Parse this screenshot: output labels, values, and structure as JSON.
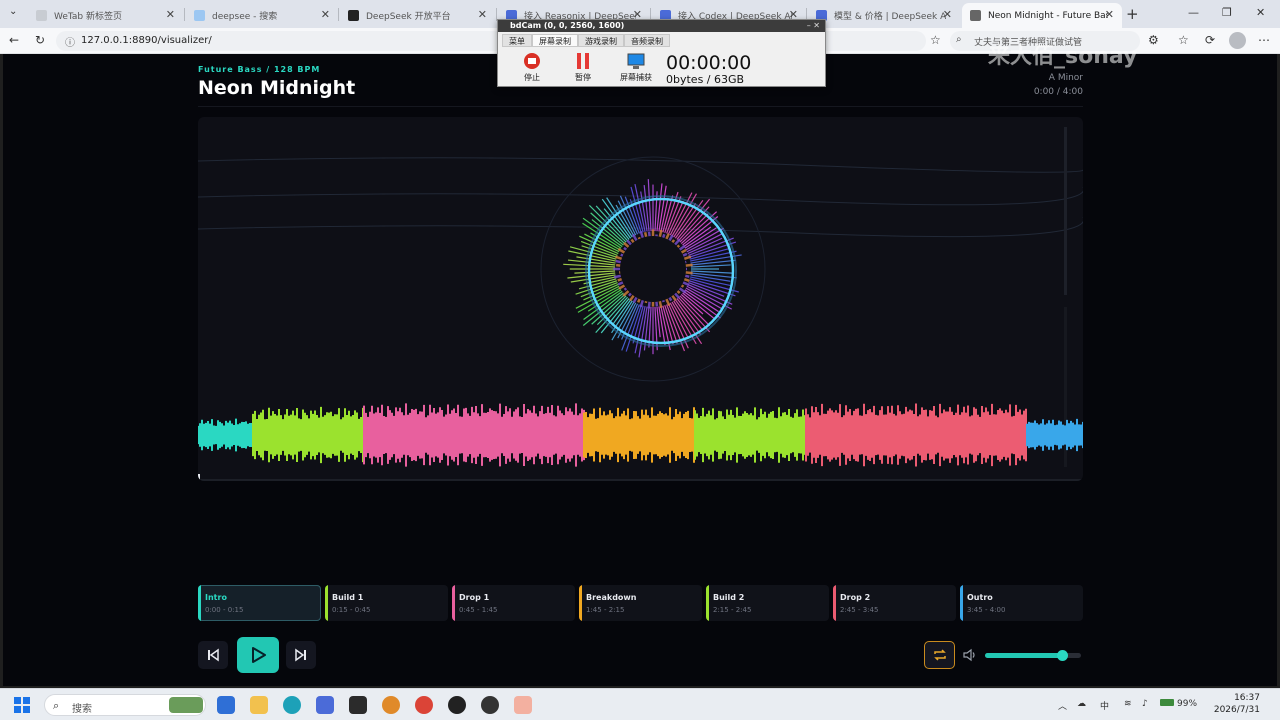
{
  "browser": {
    "tabs": [
      {
        "label": "WeTab 新标签页",
        "active": false
      },
      {
        "label": "deepsee - 搜索",
        "active": false
      },
      {
        "label": "DeepSeek 开放平台",
        "active": false
      },
      {
        "label": "接入 Reasonix | DeepSeek API",
        "active": false
      },
      {
        "label": "接入 Codex | DeepSeek API",
        "active": false
      },
      {
        "label": "模型 & 价格 | DeepSeek API",
        "active": false
      },
      {
        "label": "Neon Midnight - Future Bass",
        "active": true
      }
    ],
    "url": "127.0.0.1:8890/visualizer/",
    "search_text": "丈夫与第三者种照证做试管"
  },
  "watermark": "来大佰_sonay",
  "overlay": {
    "title": "bdCam (0, 0, 2560, 1600)",
    "tabs": [
      "菜单",
      "屏幕录制",
      "游戏录制",
      "音频录制"
    ],
    "stop_label": "停止",
    "pause_label": "暂停",
    "capture_label": "屏幕捕获",
    "timer": "00:00:00",
    "size": "0bytes / 63GB"
  },
  "track": {
    "genre": "Future Bass / 128 BPM",
    "title": "Neon Midnight",
    "key": "A Minor",
    "time": "0:00 / 4:00"
  },
  "sections": [
    {
      "name": "Intro",
      "range": "0:00 - 0:15",
      "color": "#2ad8c2",
      "active": true
    },
    {
      "name": "Build 1",
      "range": "0:15 - 0:45",
      "color": "#9be22e",
      "active": false
    },
    {
      "name": "Drop 1",
      "range": "0:45 - 1:45",
      "color": "#e8609e",
      "active": false
    },
    {
      "name": "Breakdown",
      "range": "1:45 - 2:15",
      "color": "#f0a821",
      "active": false
    },
    {
      "name": "Build 2",
      "range": "2:15 - 2:45",
      "color": "#9be22e",
      "active": false
    },
    {
      "name": "Drop 2",
      "range": "2:45 - 3:45",
      "color": "#ec5c72",
      "active": false
    },
    {
      "name": "Outro",
      "range": "3:45 - 4:00",
      "color": "#39a7ea",
      "active": false
    }
  ],
  "controls": {
    "volume_fraction": 0.8,
    "loop_enabled": true,
    "accent": "#22c7b3"
  },
  "taskbar": {
    "search_label": "搜索",
    "ime": "中",
    "battery": "99%",
    "time": "16:37",
    "date": "2026/7/31"
  }
}
